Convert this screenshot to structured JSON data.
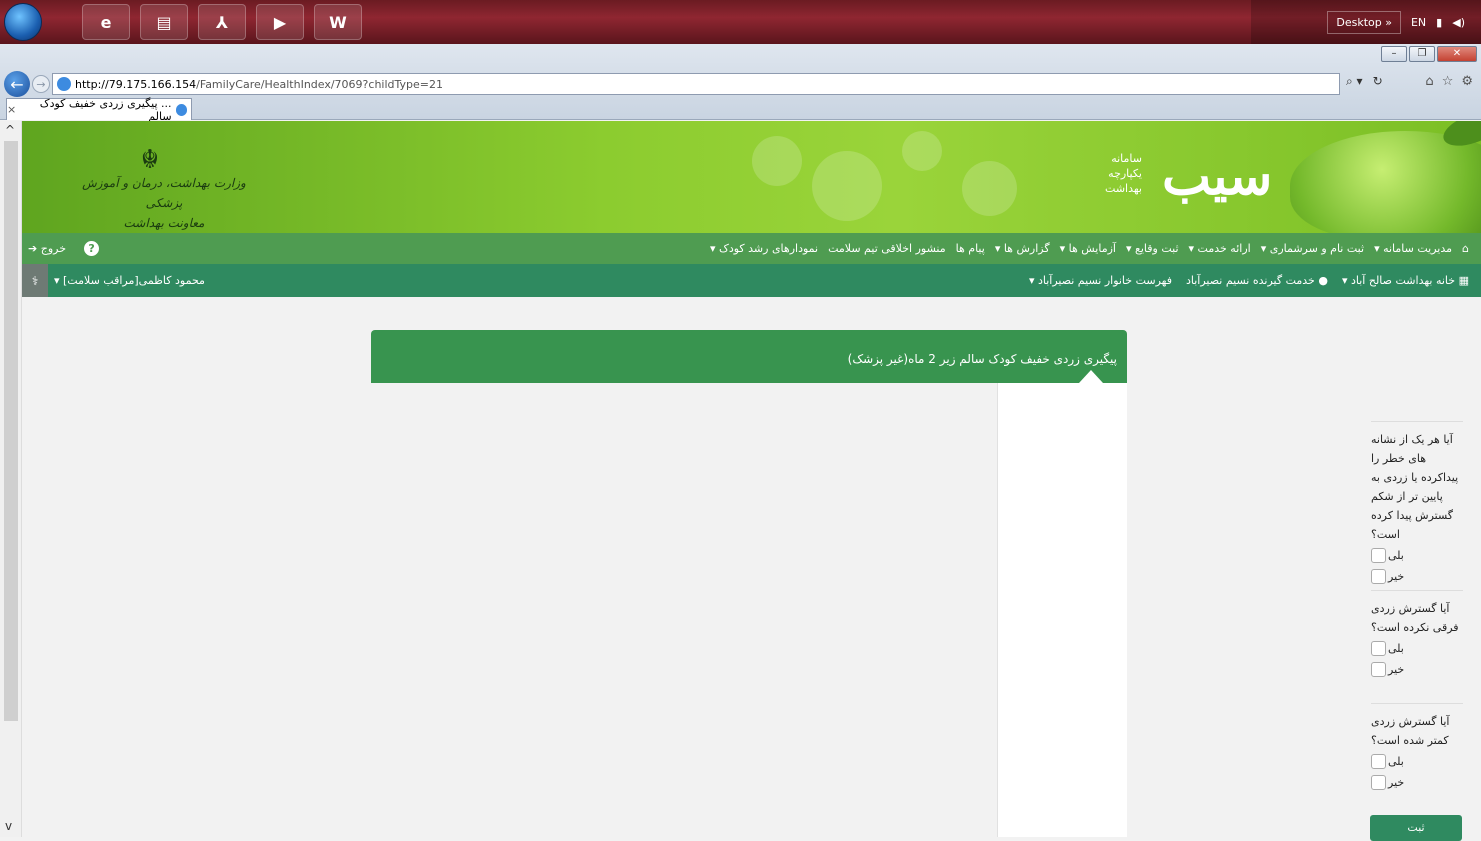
{
  "browser": {
    "url_host": "http://79.175.166.154",
    "url_path": "/FamilyCare/HealthIndex/7069?childType=21",
    "tab_title": "... پیگیری زردی خفیف کودک سالم",
    "tab_close": "×"
  },
  "taskbar": {
    "desktop_label": "Desktop",
    "chevron": "»",
    "language": "EN"
  },
  "header": {
    "ministry_line1": "وزارت بهداشت، درمان و آموزش پزشکی",
    "ministry_line2": "معاونت بهداشت",
    "logo_word": "سیب",
    "logo_sub1": "سامانه",
    "logo_sub2": "یکپارچه",
    "logo_sub3": "بهداشت"
  },
  "mainnav": {
    "items": [
      "مدیریت سامانه ▾",
      "ثبت نام و سرشماری ▾",
      "ارائه خدمت ▾",
      "ثبت وقایع ▾",
      "آزمایش ها ▾",
      "گزارش ها ▾",
      "پیام ها",
      "منشور اخلاقی تیم سلامت",
      "نمودارهای رشد کودک ▾"
    ],
    "exit_label": "خروج"
  },
  "subnav": {
    "items": [
      "خانه بهداشت صالح آباد ▾",
      "خدمت گیرنده نسیم نصیرآباد",
      "فهرست خانوار نسیم نصیرآباد ▾"
    ],
    "user": "محمود کاظمی[مراقب سلامت] ▾"
  },
  "form": {
    "title": "پیگیری زردی خفیف کودک سالم زیر 2 ماه(غیر پزشک)",
    "questions": [
      {
        "text": "آیا هر یک از نشانه های خطر را پیداکرده یا زردی به پایین تر از شکم گسترش پیدا کرده است؟",
        "yes": "بلی",
        "no": "خیر"
      },
      {
        "text": "آیا گسترش زردی فرقی نکرده است؟",
        "yes": "بلی",
        "no": "خیر"
      },
      {
        "text": "آیا گسترش زردی کمتر شده است؟",
        "yes": "بلی",
        "no": "خیر"
      }
    ],
    "submit_label": "ثبت"
  }
}
